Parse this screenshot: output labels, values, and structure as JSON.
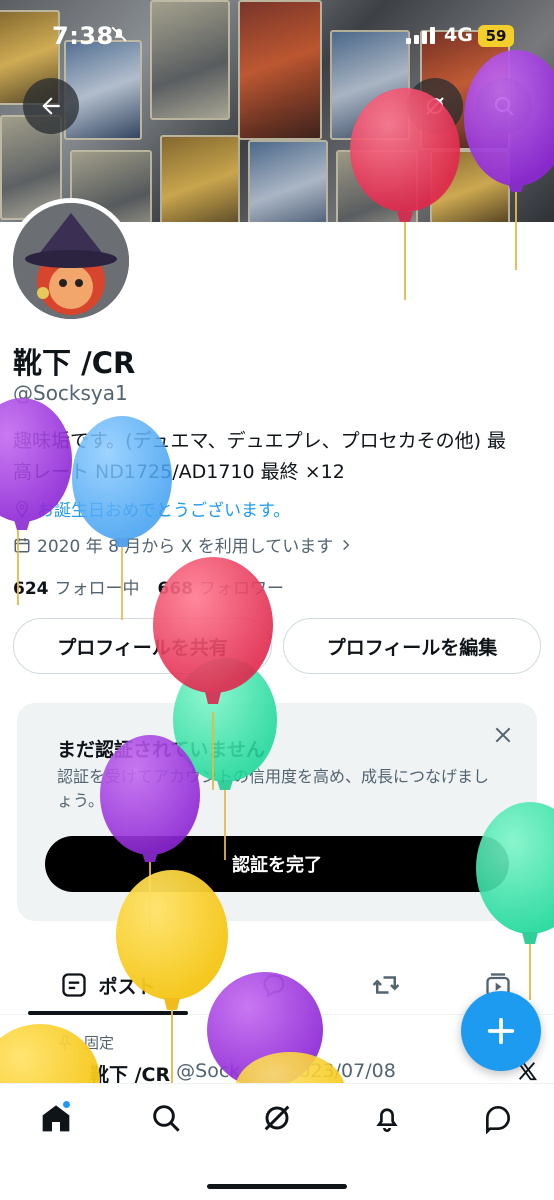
{
  "status_bar": {
    "time": "7:38",
    "network": "4G",
    "battery": "59"
  },
  "profile": {
    "display_name": "靴下 /CR",
    "handle": "@Socksya1",
    "bio_line1": "趣味垢です。(デュエマ、デュエプレ、プロセカその他) 最",
    "bio_line2": "高レート ND1725/AD1710 最終 ×12",
    "birthday_text": "お誕生日おめでとうございます。",
    "joined_text": "2020 年 8 月から X を利用しています",
    "following_count": "624",
    "following_label": "フォロー中",
    "followers_count": "668",
    "followers_label": "フォロワー"
  },
  "buttons": {
    "share_profile": "プロフィールを共有",
    "edit_profile": "プロフィールを編集"
  },
  "verify_card": {
    "title": "まだ認証されていません",
    "description": "認証を受けてアカウントの信用度を高め、成長につなげましょう。",
    "cta": "認証を完了"
  },
  "tabs": {
    "posts": "ポスト"
  },
  "post": {
    "pinned_label": "固定",
    "author_name": "靴下 /CR",
    "author_handle": "@Sock",
    "date": "2023/07/08"
  },
  "icons": {
    "back": "arrow-left-icon",
    "grok": "grok-icon",
    "search": "search-icon",
    "close": "close-icon",
    "calendar": "calendar-icon",
    "location": "location-pin-icon",
    "fab": "plus-icon",
    "nav": [
      "home-icon",
      "search-icon",
      "grok-icon",
      "bell-icon",
      "envelope-icon"
    ]
  },
  "colors": {
    "accent": "#1d9bf0",
    "text": "#0f1419",
    "muted": "#536471",
    "card_bg": "#eff3f4"
  }
}
